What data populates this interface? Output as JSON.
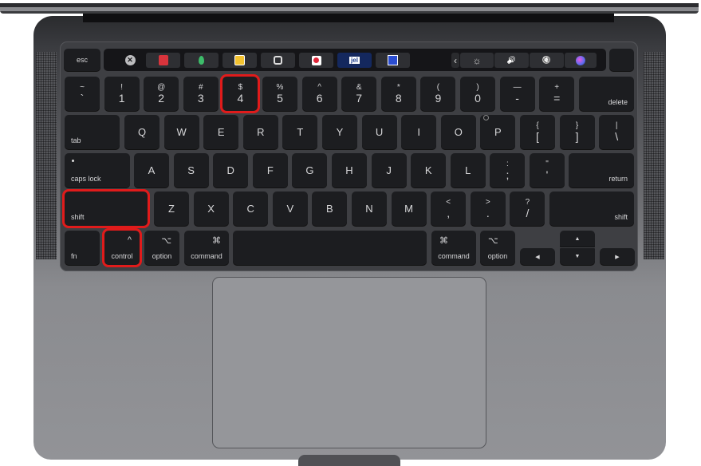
{
  "highlight_color": "#e01b1b",
  "touch_bar": {
    "esc": "esc",
    "apps": [
      {
        "icon": "close-circle-icon",
        "glyph": "✕"
      },
      {
        "icon": "app-red-tile-icon",
        "glyph": "▦"
      },
      {
        "icon": "evernote-leaf-icon",
        "glyph": "●"
      },
      {
        "icon": "app-yellow-tile-icon",
        "glyph": "■"
      },
      {
        "icon": "app-badge-icon",
        "glyph": "◎"
      },
      {
        "icon": "app-record-icon",
        "glyph": "●"
      },
      {
        "icon": "jel-app-icon",
        "glyph": "jel"
      },
      {
        "icon": "app-blue-tile-icon",
        "glyph": "▣"
      }
    ],
    "controls": [
      {
        "icon": "chevron-left-icon",
        "glyph": "‹"
      },
      {
        "icon": "brightness-icon",
        "glyph": "☼"
      },
      {
        "icon": "volume-icon",
        "glyph": "🔊"
      },
      {
        "icon": "mute-icon",
        "glyph": "🔇"
      },
      {
        "icon": "siri-icon",
        "glyph": "●"
      }
    ]
  },
  "rows": {
    "numbers": [
      {
        "top": "~",
        "bot": "`"
      },
      {
        "top": "!",
        "bot": "1"
      },
      {
        "top": "@",
        "bot": "2"
      },
      {
        "top": "#",
        "bot": "3"
      },
      {
        "top": "$",
        "bot": "4",
        "highlighted": true
      },
      {
        "top": "%",
        "bot": "5"
      },
      {
        "top": "^",
        "bot": "6"
      },
      {
        "top": "&",
        "bot": "7"
      },
      {
        "top": "*",
        "bot": "8"
      },
      {
        "top": "(",
        "bot": "9"
      },
      {
        "top": ")",
        "bot": "0"
      },
      {
        "top": "—",
        "bot": "-"
      },
      {
        "top": "+",
        "bot": "="
      }
    ],
    "delete": "delete",
    "tab": "tab",
    "qwerty": [
      "Q",
      "W",
      "E",
      "R",
      "T",
      "Y",
      "U",
      "I",
      "O",
      "P"
    ],
    "brackets": [
      {
        "top": "{",
        "bot": "["
      },
      {
        "top": "}",
        "bot": "]"
      },
      {
        "top": "|",
        "bot": "\\"
      }
    ],
    "caps_lock": "caps lock",
    "asdf": [
      "A",
      "S",
      "D",
      "F",
      "G",
      "H",
      "J",
      "K",
      "L"
    ],
    "punct_home": [
      {
        "top": ":",
        "bot": ";"
      },
      {
        "top": "\"",
        "bot": "'"
      }
    ],
    "return": "return",
    "shift_left": "shift",
    "zxcv": [
      "Z",
      "X",
      "C",
      "V",
      "B",
      "N",
      "M"
    ],
    "punct_bottom": [
      {
        "top": "<",
        "bot": ","
      },
      {
        "top": ">",
        "bot": "."
      },
      {
        "top": "?",
        "bot": "/"
      }
    ],
    "shift_right": "shift",
    "bottom": {
      "fn": "fn",
      "control": {
        "sym": "^",
        "label": "control"
      },
      "option_left": {
        "sym": "⌥",
        "label": "option"
      },
      "command_left": {
        "sym": "⌘",
        "label": "command"
      },
      "command_right": {
        "sym": "⌘",
        "label": "command"
      },
      "option_right": {
        "sym": "⌥",
        "label": "option"
      },
      "arrows": {
        "up": "▲",
        "down": "▼",
        "left": "◀",
        "right": "▶"
      }
    }
  },
  "highlighted_keys": [
    "4",
    "shift",
    "control"
  ]
}
